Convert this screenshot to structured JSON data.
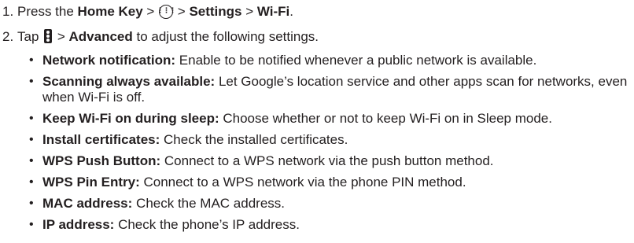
{
  "steps": [
    {
      "number": "1.",
      "text_before": "Press the ",
      "home_key": "Home Key",
      "sep1": " > ",
      "apps_icon": "apps-grid-icon",
      "sep2": " > ",
      "settings": "Settings",
      "sep3": " > ",
      "wifi": "Wi-Fi",
      "end": "."
    },
    {
      "number": "2.",
      "text_before": "Tap ",
      "menu_icon": "overflow-menu-icon",
      "sep1": " > ",
      "advanced": "Advanced",
      "text_after": " to adjust the following settings."
    }
  ],
  "settings": [
    {
      "label": "Network notification:",
      "desc": " Enable to be notified whenever a public network is available."
    },
    {
      "label": "Scanning always available:",
      "desc": " Let Google’s location service and other apps scan for networks, even when Wi-Fi is off."
    },
    {
      "label": "Keep Wi-Fi on during sleep:",
      "desc": " Choose whether or not to keep Wi-Fi on in Sleep mode."
    },
    {
      "label": "Install certificates:",
      "desc": " Check the installed certificates."
    },
    {
      "label": "WPS Push Button:",
      "desc": " Connect to a WPS network via the push button method."
    },
    {
      "label": "WPS Pin Entry:",
      "desc": " Connect to a WPS network via the phone PIN method."
    },
    {
      "label": "MAC address:",
      "desc": " Check the MAC address."
    },
    {
      "label": "IP address:",
      "desc": " Check the phone’s IP address."
    }
  ]
}
